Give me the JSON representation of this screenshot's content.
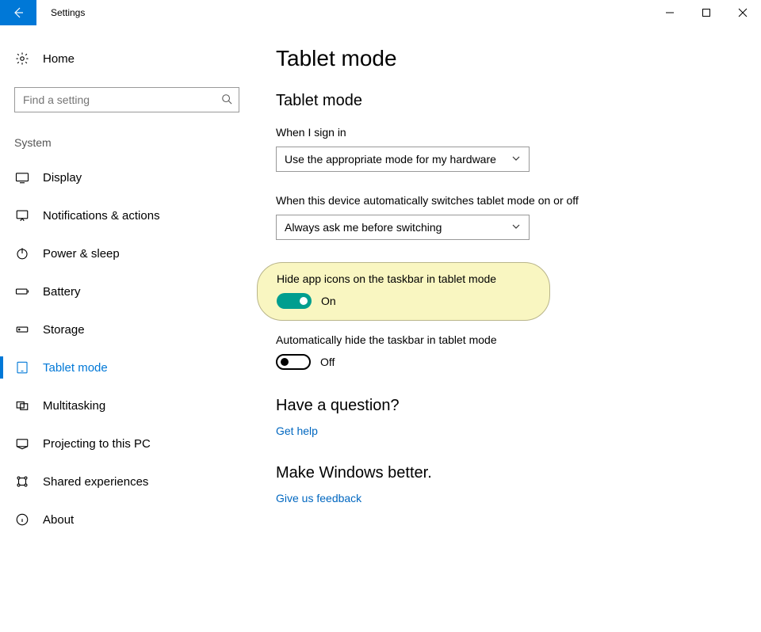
{
  "window": {
    "title": "Settings"
  },
  "sidebar": {
    "home_label": "Home",
    "search_placeholder": "Find a setting",
    "group_label": "System",
    "items": [
      {
        "label": "Display"
      },
      {
        "label": "Notifications & actions"
      },
      {
        "label": "Power & sleep"
      },
      {
        "label": "Battery"
      },
      {
        "label": "Storage"
      },
      {
        "label": "Tablet mode"
      },
      {
        "label": "Multitasking"
      },
      {
        "label": "Projecting to this PC"
      },
      {
        "label": "Shared experiences"
      },
      {
        "label": "About"
      }
    ]
  },
  "content": {
    "page_title": "Tablet mode",
    "section_heading": "Tablet mode",
    "sign_in": {
      "label": "When I sign in",
      "value": "Use the appropriate mode for my hardware"
    },
    "auto_switch": {
      "label": "When this device automatically switches tablet mode on or off",
      "value": "Always ask me before switching"
    },
    "hide_icons": {
      "label": "Hide app icons on the taskbar in tablet mode",
      "state": "On"
    },
    "auto_hide_taskbar": {
      "label": "Automatically hide the taskbar in tablet mode",
      "state": "Off"
    },
    "question": {
      "heading": "Have a question?",
      "link": "Get help"
    },
    "feedback": {
      "heading": "Make Windows better.",
      "link": "Give us feedback"
    }
  }
}
